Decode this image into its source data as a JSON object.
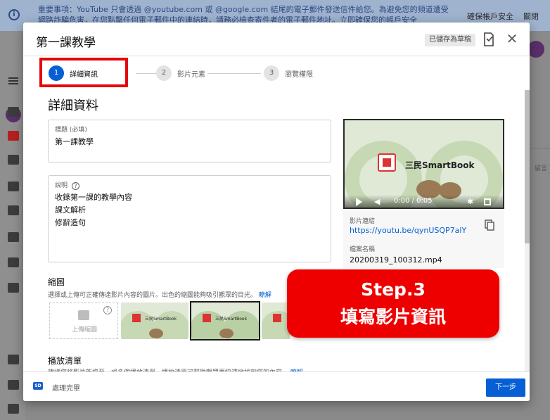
{
  "banner": {
    "text": "重要事項：YouTube 只會透過 @youtube.com 或 @google.com 結尾的電子郵件發送信件給您。為避免您的頻道遭受網路詐騙危害，在您點擊任何電子郵件中的連結時，請務必檢查寄件者的電子郵件地址。立即確保您的帳戶安全",
    "secure_link": "確保帳戶安全",
    "dismiss_link": "關閉"
  },
  "background": {
    "right_text": "留言"
  },
  "dialog": {
    "title": "第一課教學",
    "saved_badge": "已儲存為草稿",
    "close_glyph": "✕"
  },
  "stepper": {
    "steps": [
      {
        "number": "1",
        "label": "詳細資訊",
        "active": true
      },
      {
        "number": "2",
        "label": "影片元素",
        "active": false
      },
      {
        "number": "3",
        "label": "瀏覽權限",
        "active": false
      }
    ]
  },
  "details": {
    "section_title": "詳細資料",
    "title_field": {
      "label": "標題 (必填)",
      "value": "第一課教學"
    },
    "description_field": {
      "label": "說明",
      "help_glyph": "?",
      "value": "收錄第一課的教學內容\n課文解析\n修辭造句"
    }
  },
  "video": {
    "brand_text": "三民SmartBook",
    "time": "0:00 / 0:05",
    "link_label": "影片連結",
    "link": "https://youtu.be/qynUSQP7alY",
    "filename_label": "檔案名稱",
    "filename": "20200319_100312.mp4"
  },
  "thumbnail": {
    "title": "縮圖",
    "description": "選擇或上傳可正確傳達影片內容的圖片。出色的縮圖能夠吸引觀眾的目光。",
    "more_link": "瞭解",
    "upload_label": "上傳縮圖",
    "help_glyph": "?",
    "option_brand": "三民SmartBook"
  },
  "playlist": {
    "title": "播放清單",
    "description": "建議您將影片新增至一或多個播放清單。播放清單可幫助觀眾更快速地找到您的內容。",
    "more_link": "瞭解"
  },
  "footer": {
    "sd_badge": "SD",
    "status": "處理完畢",
    "next_button": "下一步"
  },
  "callout": {
    "line1": "Step.3",
    "line2": "填寫影片資訊"
  },
  "colors": {
    "accent": "#065fd4",
    "callout": "#ee0000",
    "highlight": "#e5060a"
  }
}
